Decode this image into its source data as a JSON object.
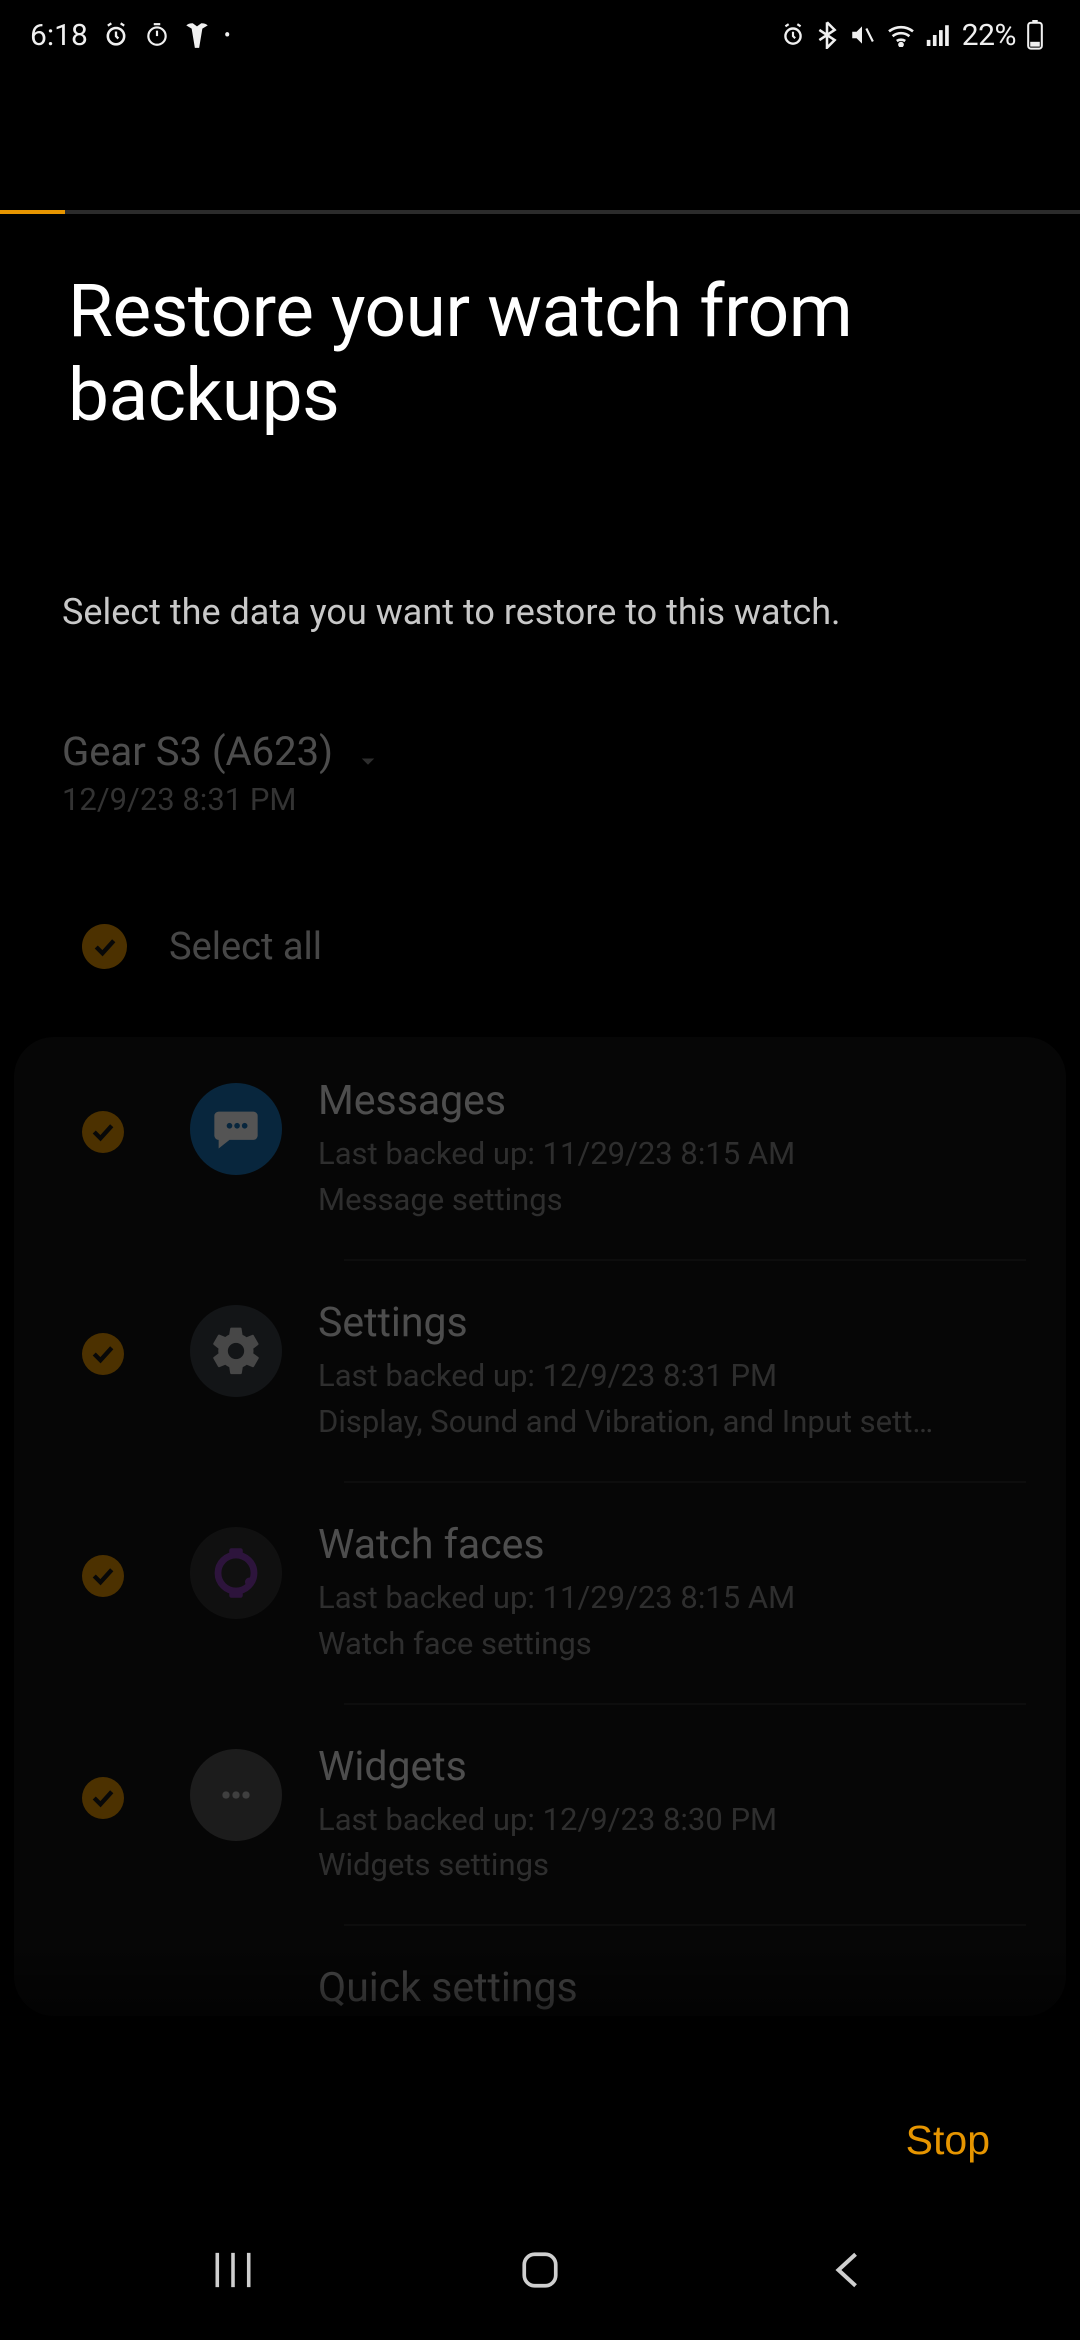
{
  "status": {
    "time": "6:18",
    "battery_percent": "22%"
  },
  "progress": {
    "percent": 6
  },
  "page": {
    "title": "Restore your watch from backups",
    "subtitle": "Select the data you want to restore to this watch."
  },
  "device": {
    "name": "Gear S3 (A623)",
    "timestamp": "12/9/23 8:31 PM"
  },
  "select_all": {
    "label": "Select all",
    "checked": true
  },
  "items": [
    {
      "title": "Messages",
      "line1": "Last backed up: 11/29/23 8:15 AM",
      "line2": "Message settings",
      "icon": "messages",
      "checked": true
    },
    {
      "title": "Settings",
      "line1": "Last backed up: 12/9/23 8:31 PM",
      "line2": "Display, Sound and Vibration, and Input sett…",
      "icon": "settings",
      "checked": true
    },
    {
      "title": "Watch faces",
      "line1": "Last backed up: 11/29/23 8:15 AM",
      "line2": "Watch face settings",
      "icon": "watchfaces",
      "checked": true
    },
    {
      "title": "Widgets",
      "line1": "Last backed up: 12/9/23 8:30 PM",
      "line2": "Widgets settings",
      "icon": "widgets",
      "checked": true
    },
    {
      "title": "Quick settings",
      "line1": "",
      "line2": "",
      "icon": "quick",
      "checked": true,
      "partial": true
    }
  ],
  "footer": {
    "stop_label": "Stop"
  },
  "colors": {
    "accent": "#e69500"
  }
}
